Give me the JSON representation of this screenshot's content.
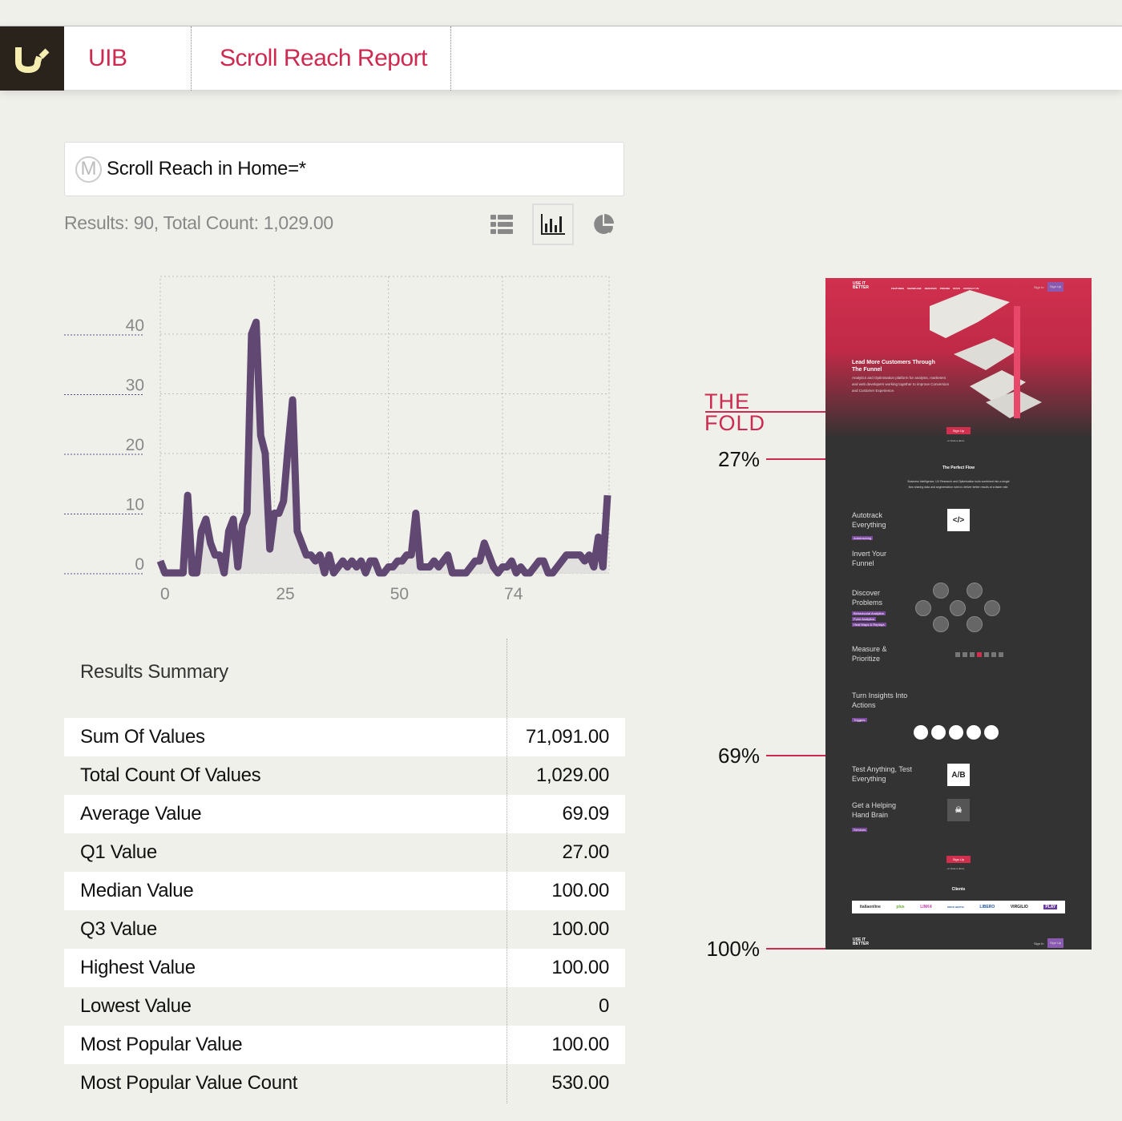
{
  "header": {
    "app": "UIB",
    "title": "Scroll Reach Report"
  },
  "query": {
    "badge": "M",
    "text": "Scroll Reach in Home=*"
  },
  "results_text": "Results: 90, Total Count: 1,029.00",
  "view_buttons": [
    {
      "icon": "list-icon",
      "active": false
    },
    {
      "icon": "bar-chart-icon",
      "active": true
    },
    {
      "icon": "pie-chart-icon",
      "active": false
    }
  ],
  "colors": {
    "accent": "#cc2a50",
    "series": "#614872",
    "fill": "#e2e0de",
    "logo_bg": "#2a231b",
    "logo_fg": "#f5eeb0"
  },
  "chart_data": {
    "type": "area",
    "x_ticks": [
      "0",
      "25",
      "50",
      "74"
    ],
    "y_ticks": [
      "0",
      "10",
      "20",
      "30",
      "40"
    ],
    "xlim": [
      0,
      98
    ],
    "ylim": [
      0,
      45
    ],
    "grid": true,
    "x": [
      0,
      1,
      2,
      3,
      4,
      5,
      6,
      7,
      8,
      9,
      10,
      11,
      12,
      13,
      14,
      15,
      16,
      17,
      18,
      19,
      20,
      21,
      22,
      23,
      24,
      25,
      26,
      27,
      28,
      29,
      30,
      31,
      32,
      33,
      34,
      35,
      36,
      37,
      38,
      39,
      40,
      41,
      42,
      43,
      44,
      45,
      46,
      47,
      48,
      49,
      50,
      51,
      52,
      53,
      54,
      55,
      56,
      57,
      58,
      59,
      60,
      61,
      62,
      63,
      64,
      65,
      66,
      67,
      68,
      69,
      70,
      71,
      72,
      73,
      74,
      75,
      76,
      77,
      78,
      79,
      80,
      81,
      82,
      83,
      84,
      85,
      86,
      87,
      88,
      89,
      90,
      91,
      92,
      93,
      94,
      95,
      96,
      97,
      98
    ],
    "values": [
      2,
      0,
      0,
      0,
      0,
      0,
      13,
      0,
      0,
      7,
      9,
      5,
      3,
      3,
      0,
      7,
      9,
      1,
      8,
      10,
      40,
      42,
      23,
      20,
      4,
      10,
      10,
      12,
      21,
      29,
      7,
      5,
      3,
      3,
      2,
      3,
      0,
      3,
      0,
      1,
      2,
      1,
      2,
      1,
      2,
      0,
      2,
      2,
      0,
      0,
      1,
      1,
      2,
      2,
      3,
      3,
      10,
      1,
      1,
      1,
      2,
      1,
      2,
      3,
      0,
      0,
      0,
      0,
      1,
      2,
      2,
      5,
      3,
      1,
      0,
      1,
      1,
      2,
      0,
      1,
      0,
      0,
      1,
      2,
      2,
      0,
      0,
      1,
      2,
      3,
      3,
      3,
      3,
      2,
      3,
      1,
      6,
      1,
      13
    ]
  },
  "summary": {
    "title": "Results Summary",
    "rows": [
      {
        "label": "Sum Of Values",
        "value": "71,091.00"
      },
      {
        "label": "Total Count Of Values",
        "value": "1,029.00"
      },
      {
        "label": "Average Value",
        "value": "69.09"
      },
      {
        "label": "Q1 Value",
        "value": "27.00"
      },
      {
        "label": "Median Value",
        "value": "100.00"
      },
      {
        "label": "Q3 Value",
        "value": "100.00"
      },
      {
        "label": "Highest Value",
        "value": "100.00"
      },
      {
        "label": "Lowest Value",
        "value": "0"
      },
      {
        "label": "Most Popular Value",
        "value": "100.00"
      },
      {
        "label": "Most Popular Value Count",
        "value": "530.00"
      }
    ]
  },
  "fold": {
    "line1": "THE",
    "line2": "FOLD"
  },
  "markers": [
    "27%",
    "69%",
    "100%"
  ],
  "thumbnail": {
    "nav": [
      "FEATURES",
      "SHOWCASE",
      "SERVICES",
      "PRICING",
      "DOCS",
      "CONTACT US"
    ],
    "sign_in": "Sign In",
    "sign_up": "Sign Up",
    "hero_title": "Lead More Customers Through The Funnel",
    "hero_text": "Analytics and Optimisation platform for analysts, marketers and web developers working together to improve Conversion and Customer Experience.",
    "book_demo": "...or book a demo",
    "flow_title": "The Perfect Flow",
    "flow_text": "Business Intelligence, UX Research and Optimisation tools combined into a single flow sharing data and segmentation rules to deliver better results at a faster rate.",
    "features": [
      {
        "title": "Autotrack Everything",
        "tags": [
          "Autotracking"
        ]
      },
      {
        "title": "Invert Your Funnel",
        "tags": []
      },
      {
        "title": "Discover Problems",
        "tags": [
          "Behavioural Analytics",
          "Form Analytics",
          "Heat Maps & Replays"
        ]
      },
      {
        "title": "Measure & Prioritize",
        "tags": []
      },
      {
        "title": "Turn Insights Into Actions",
        "tags": [
          "Triggers"
        ]
      },
      {
        "title": "Test Anything, Test Everything",
        "tags": []
      },
      {
        "title": "Get a Helping Hand Brain",
        "tags": [
          "Services"
        ]
      }
    ],
    "clients_title": "Clients",
    "clients": [
      "italiaonline",
      "plus",
      "LINK4",
      "ERGO HESTIA",
      "LIBERO",
      "VIRGILIO",
      "PLAY"
    ]
  }
}
